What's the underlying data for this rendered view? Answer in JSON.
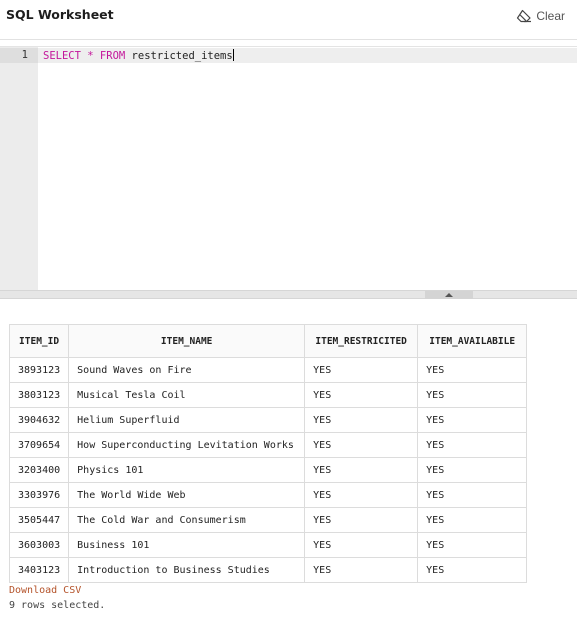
{
  "header": {
    "title": "SQL Worksheet",
    "clear_label": "Clear"
  },
  "editor": {
    "line_number": "1",
    "keyword_select": "SELECT",
    "operator_star": "*",
    "keyword_from": "FROM",
    "table_name": "restricted_items"
  },
  "results": {
    "columns": [
      "ITEM_ID",
      "ITEM_NAME",
      "ITEM_RESTRICITED",
      "ITEM_AVAILABILE"
    ],
    "rows": [
      [
        "3893123",
        "Sound Waves on Fire",
        "YES",
        "YES"
      ],
      [
        "3803123",
        "Musical Tesla Coil",
        "YES",
        "YES"
      ],
      [
        "3904632",
        "Helium Superfluid",
        "YES",
        "YES"
      ],
      [
        "3709654",
        "How Superconducting Levitation Works",
        "YES",
        "YES"
      ],
      [
        "3203400",
        "Physics 101",
        "YES",
        "YES"
      ],
      [
        "3303976",
        "The World Wide Web",
        "YES",
        "YES"
      ],
      [
        "3505447",
        "The Cold War and Consumerism",
        "YES",
        "YES"
      ],
      [
        "3603003",
        "Business 101",
        "YES",
        "YES"
      ],
      [
        "3403123",
        "Introduction to Business Studies",
        "YES",
        "YES"
      ]
    ],
    "download_label": "Download CSV",
    "status": "9 rows selected."
  },
  "icons": {
    "clear": "eraser-icon",
    "splitter": "caret-up-icon"
  },
  "colors": {
    "keyword": "#c3169b",
    "link": "#b4532a"
  }
}
